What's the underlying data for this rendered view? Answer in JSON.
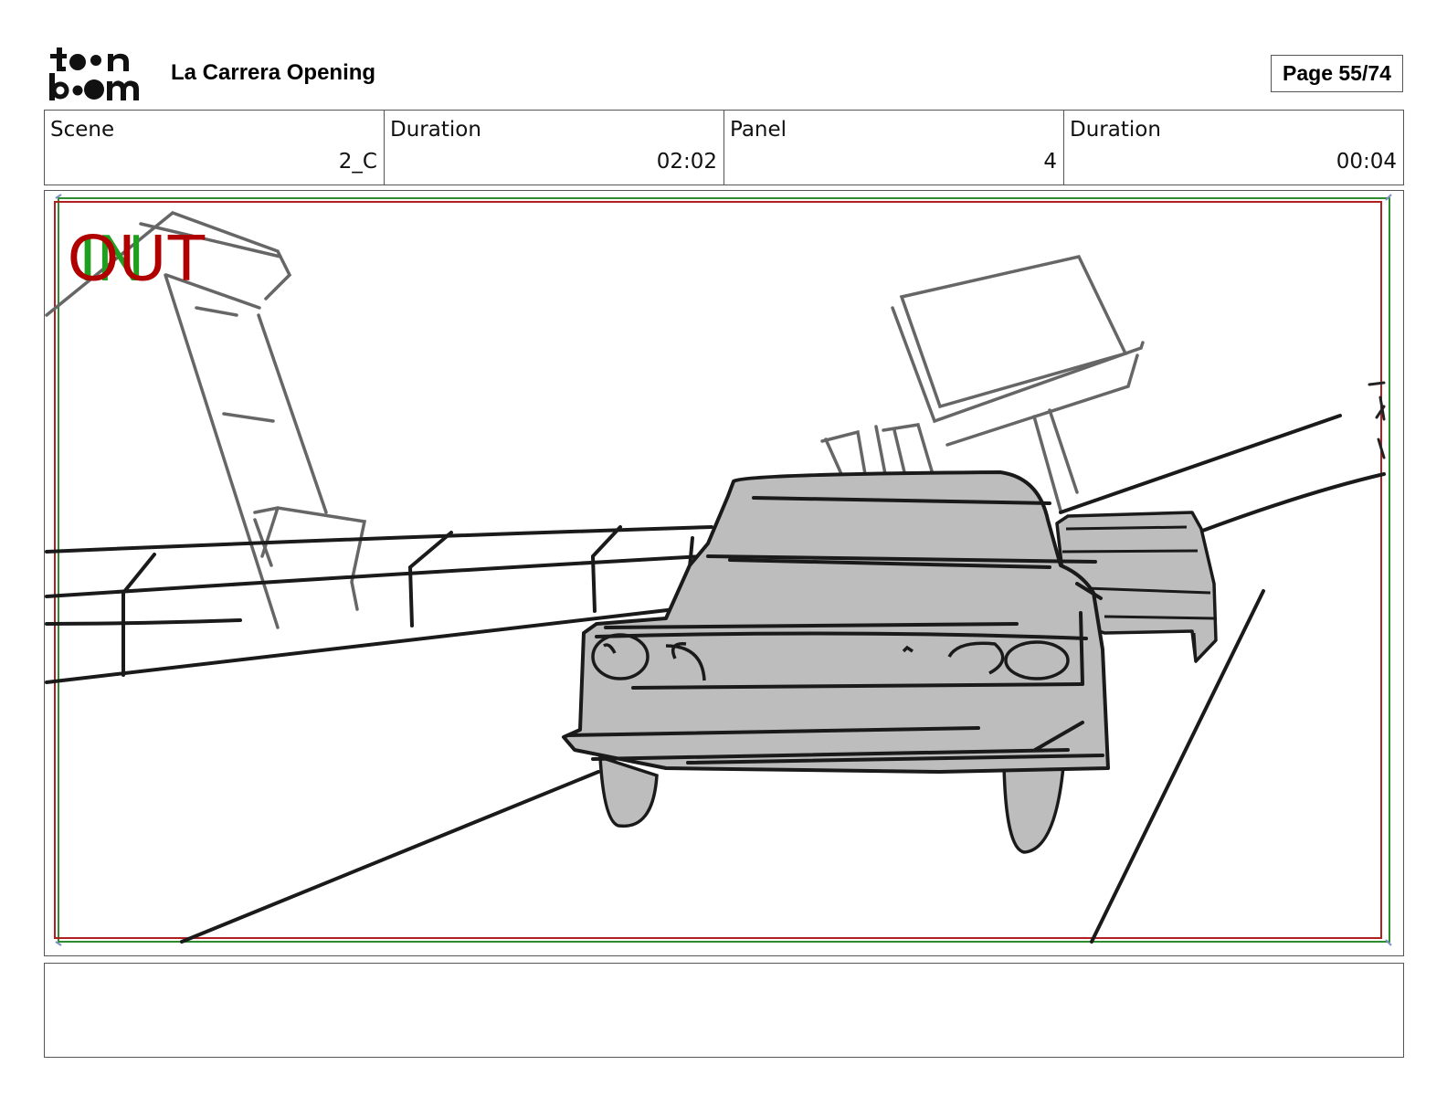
{
  "header": {
    "logo_text": "toon boom",
    "title": "La Carrera Opening",
    "page_label": "Page 55/74"
  },
  "info": [
    {
      "label": "Scene",
      "value": "2_C"
    },
    {
      "label": "Duration",
      "value": "02:02"
    },
    {
      "label": "Panel",
      "value": "4"
    },
    {
      "label": "Duration",
      "value": "00:04"
    }
  ],
  "panel": {
    "safe_in_label": "IN",
    "safe_out_label": "OUT",
    "in_color": "#1ea01e",
    "out_color": "#b00000",
    "car_fill": "#bdbdbd",
    "line_color": "#1a1a1a",
    "background_line_color": "#666666"
  },
  "notes": {
    "text": ""
  }
}
